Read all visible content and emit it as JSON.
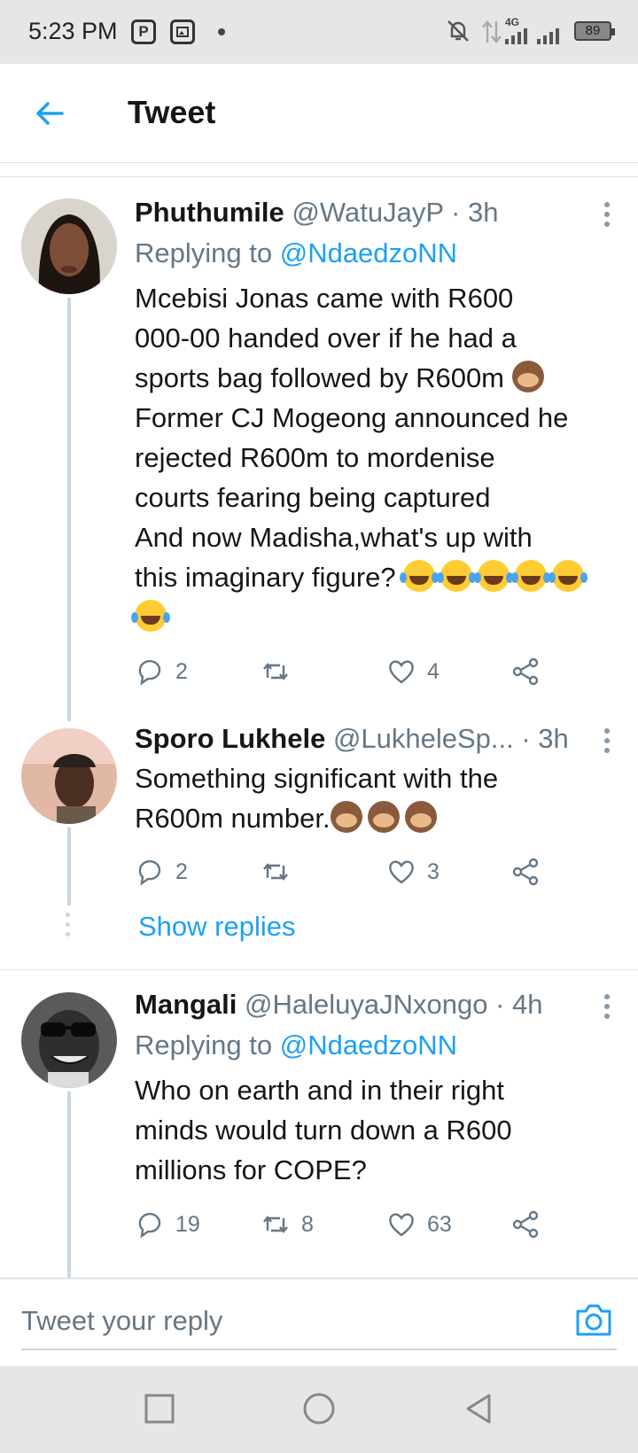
{
  "status_bar": {
    "time": "5:23 PM",
    "app_icon_1": "P",
    "network": "4G",
    "battery": "89"
  },
  "header": {
    "title": "Tweet"
  },
  "tweets": [
    {
      "name": "Phuthumile",
      "handle": "@WatuJayP · 3h",
      "replying_prefix": "Replying to ",
      "replying_to": "@NdaedzoNN",
      "body_lines": [
        "Mcebisi Jonas came with R600",
        "000-00 handed over if he had a",
        "sports bag followed by R600m",
        "Former CJ Mogeong announced he",
        "rejected R600m to mordenise",
        "courts fearing being captured",
        "And now Madisha,what's up with",
        "this imaginary figure?"
      ],
      "replies": "2",
      "retweets": "",
      "likes": "4"
    },
    {
      "name": "Sporo Lukhele",
      "handle": "@LukheleSp... · 3h",
      "body_lines": [
        "Something significant with the",
        "R600m number."
      ],
      "replies": "2",
      "retweets": "",
      "likes": "3"
    },
    {
      "name": "Mangali",
      "handle": "@HaleluyaJNxongo · 4h",
      "replying_prefix": "Replying to ",
      "replying_to": "@NdaedzoNN",
      "body_lines": [
        "Who on earth and in their right",
        "minds would turn down a R600",
        "millions for COPE?"
      ],
      "replies": "19",
      "retweets": "8",
      "likes": "63"
    }
  ],
  "show_replies": "Show replies",
  "reply_bar": {
    "placeholder": "Tweet your reply"
  },
  "colors": {
    "accent": "#1da1f2",
    "text": "#14171a",
    "muted": "#657786"
  }
}
